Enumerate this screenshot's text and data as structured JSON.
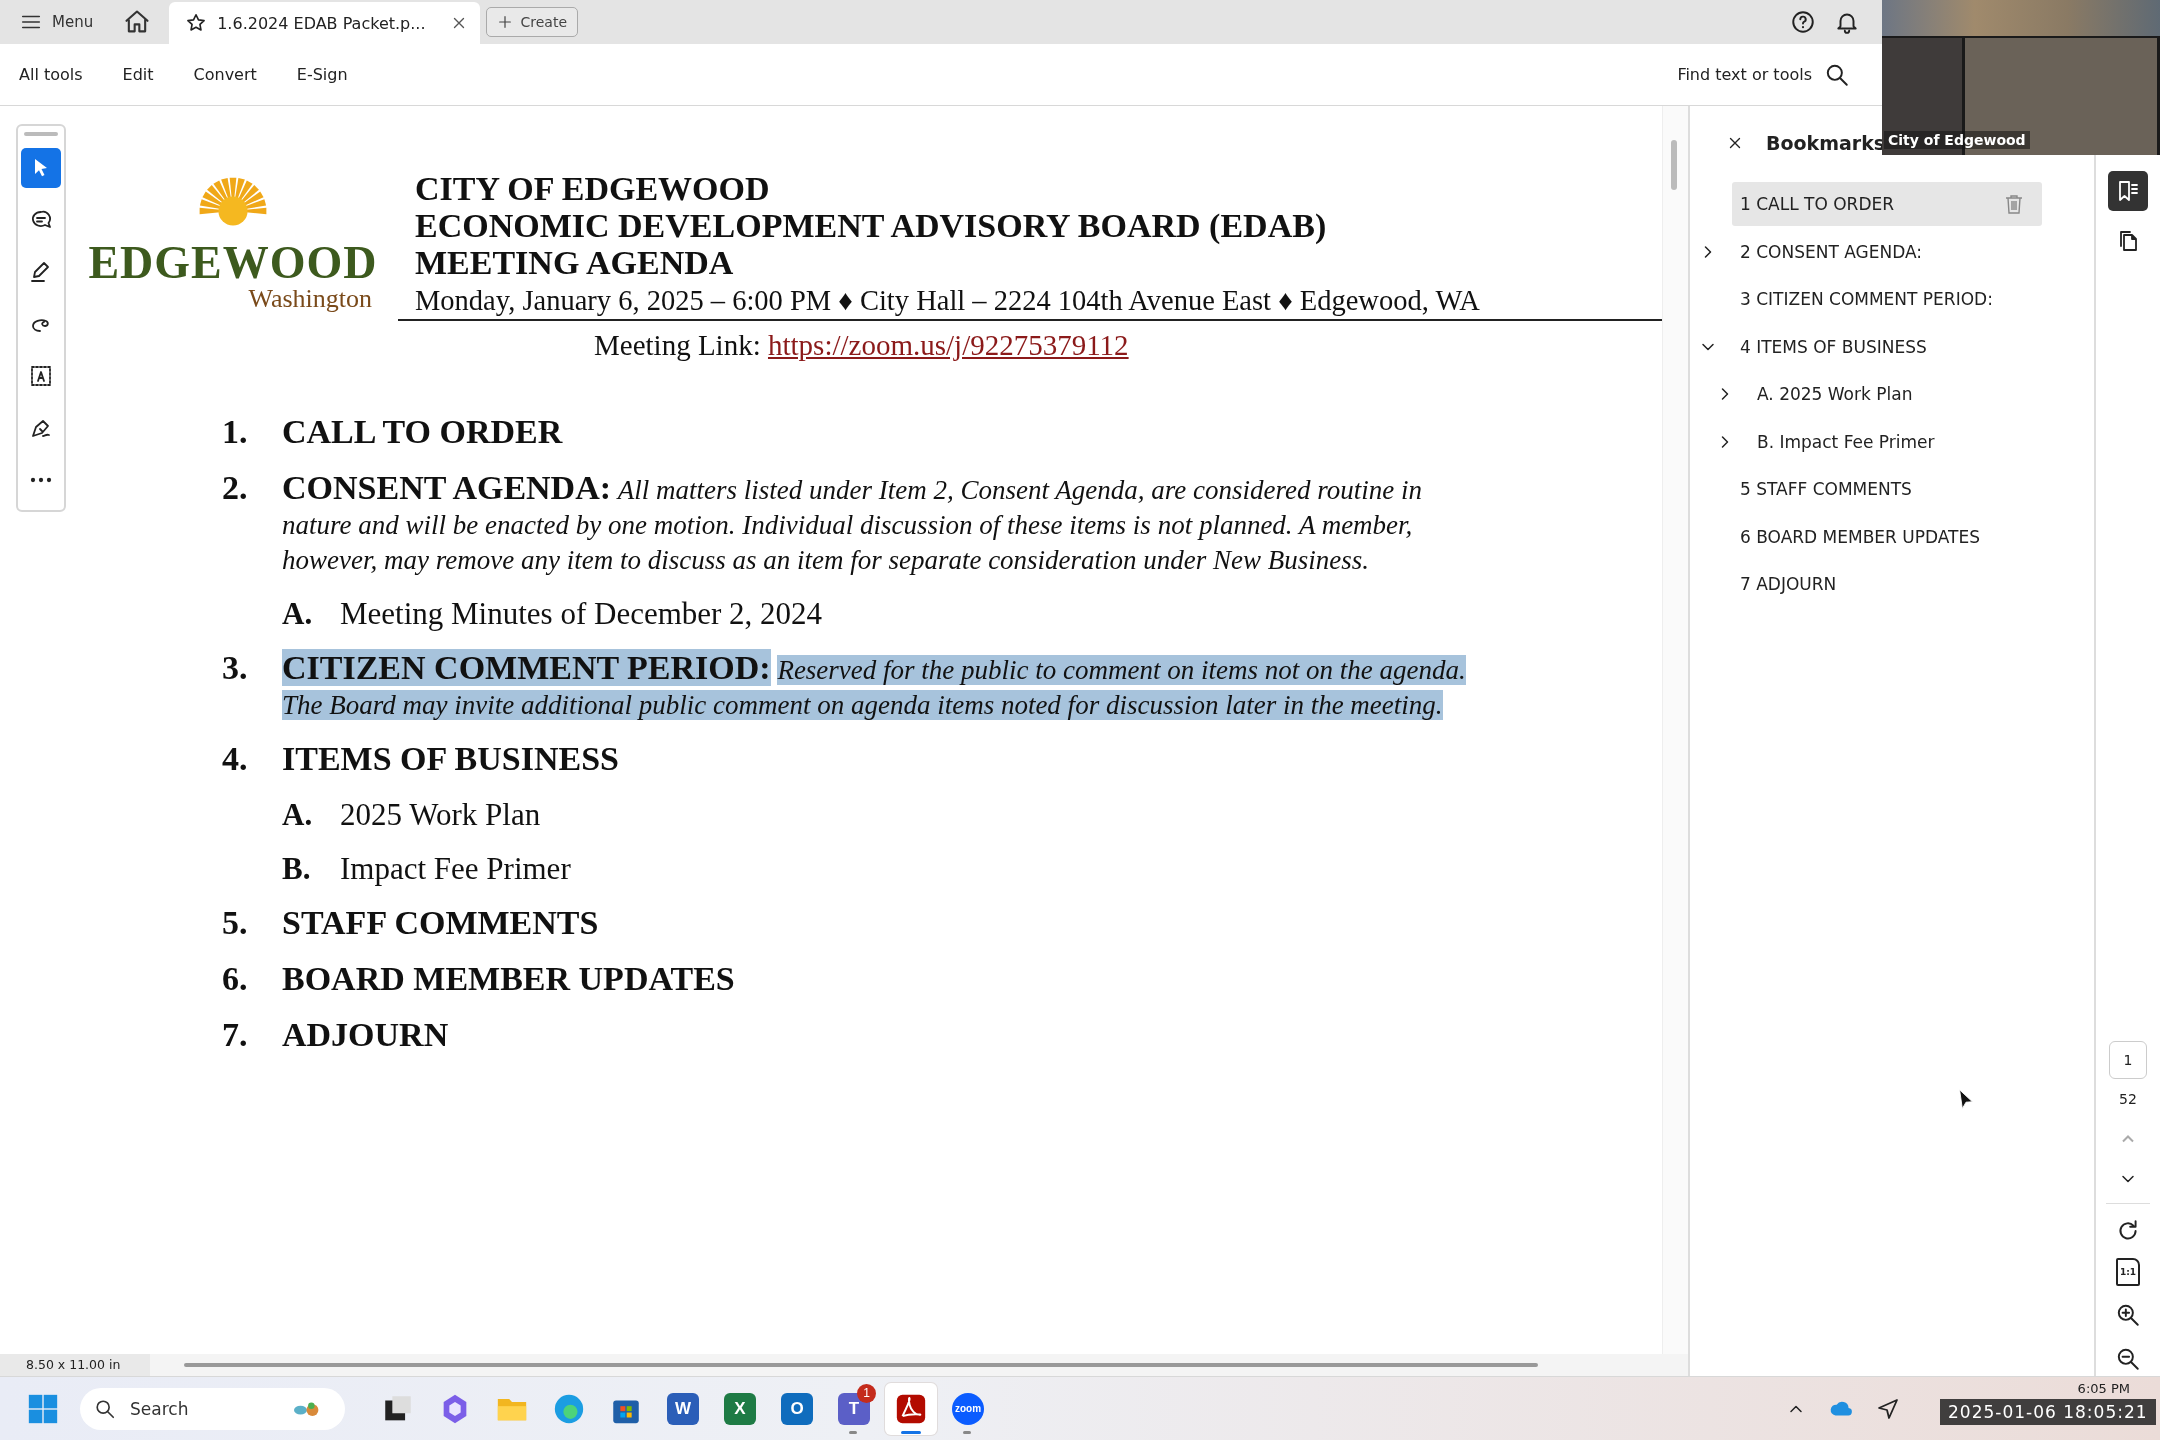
{
  "tab_bar": {
    "menu": "Menu",
    "tabs": [
      {
        "title": "1.6.2024 EDAB Packet.p...",
        "selected": true
      }
    ],
    "create": "Create"
  },
  "toolbar": {
    "menus": [
      "All tools",
      "Edit",
      "Convert",
      "E-Sign"
    ],
    "search": "Find text or tools"
  },
  "tools": [
    {
      "kind": "select",
      "selected": true
    },
    {
      "kind": "comment",
      "selected": false
    },
    {
      "kind": "highlight",
      "selected": false
    },
    {
      "kind": "draw",
      "selected": false
    },
    {
      "kind": "text-box",
      "selected": false
    },
    {
      "kind": "sign",
      "selected": false
    },
    {
      "kind": "more",
      "selected": false
    }
  ],
  "document": {
    "logo": {
      "name": "EDGEWOOD",
      "subtitle": "Washington"
    },
    "title_lines": [
      "CITY OF EDGEWOOD",
      "ECONOMIC DEVELOPMENT ADVISORY BOARD (EDAB)",
      "MEETING AGENDA"
    ],
    "date_line": "Monday, January 6, 2025 – 6:00 PM ♦ City Hall – 2224 104th Avenue East ♦ Edgewood, WA",
    "meeting_link": {
      "label": "Meeting Link:",
      "url": "https://zoom.us/j/92275379112"
    },
    "agenda": [
      {
        "number": "1.",
        "title": "CALL TO ORDER",
        "highlighted": false
      },
      {
        "number": "2.",
        "title": "CONSENT AGENDA:",
        "description": "All matters listed under Item 2, Consent Agenda, are considered routine in nature and will be enacted by one motion. Individual discussion of these items is not planned. A member, however, may remove any item to discuss as an item for separate consideration under New Business.",
        "highlighted": false,
        "children": [
          {
            "letter": "A.",
            "title": "Meeting Minutes of December 2, 2024"
          }
        ]
      },
      {
        "number": "3.",
        "title": "CITIZEN COMMENT PERIOD:",
        "description": "Reserved for the public to comment on items not on the agenda. The Board may invite additional public comment on agenda items noted for discussion later in the meeting.",
        "highlighted": true
      },
      {
        "number": "4.",
        "title": "ITEMS OF BUSINESS",
        "highlighted": false,
        "children": [
          {
            "letter": "A.",
            "title": "2025 Work Plan"
          },
          {
            "letter": "B.",
            "title": "Impact Fee Primer"
          }
        ]
      },
      {
        "number": "5.",
        "title": "STAFF COMMENTS",
        "highlighted": false
      },
      {
        "number": "6.",
        "title": "BOARD MEMBER UPDATES",
        "highlighted": false
      },
      {
        "number": "7.",
        "title": "ADJOURN",
        "highlighted": false
      }
    ]
  },
  "bookmarks": {
    "title": "Bookmarks",
    "items": [
      {
        "label": "1 CALL TO ORDER",
        "selected": true
      },
      {
        "label": "2 CONSENT AGENDA:",
        "expanded": false,
        "selected": false
      },
      {
        "label": "3 CITIZEN COMMENT PERIOD:",
        "selected": false
      },
      {
        "label": "4 ITEMS OF BUSINESS",
        "expanded": true,
        "selected": false,
        "children": [
          {
            "label": "A. 2025 Work Plan",
            "expanded": false,
            "selected": false
          },
          {
            "label": "B. Impact Fee Primer",
            "expanded": false,
            "selected": false
          }
        ]
      },
      {
        "label": "5 STAFF COMMENTS",
        "selected": false
      },
      {
        "label": "6 BOARD MEMBER UPDATES",
        "selected": false
      },
      {
        "label": "7 ADJOURN",
        "selected": false
      }
    ]
  },
  "page_nav": {
    "current": "1",
    "total": "52",
    "actual_size": "1:1"
  },
  "status": {
    "page_size": "8.50 x 11.00 in"
  },
  "video": {
    "caption": "City of Edgewood"
  },
  "taskbar": {
    "search": "Search",
    "apps": [
      {
        "kind": "task-view",
        "running": false,
        "selected": false
      },
      {
        "kind": "copilot",
        "running": false,
        "selected": false
      },
      {
        "kind": "folder",
        "running": false,
        "selected": false
      },
      {
        "kind": "edge",
        "running": false,
        "selected": false
      },
      {
        "kind": "store",
        "running": false,
        "selected": false
      },
      {
        "kind": "word",
        "label": "W",
        "running": false,
        "selected": false
      },
      {
        "kind": "excel",
        "label": "X",
        "running": false,
        "selected": false
      },
      {
        "kind": "outlook",
        "label": "O",
        "running": false,
        "selected": false
      },
      {
        "kind": "teams",
        "label": "T",
        "badge": "1",
        "running": true,
        "selected": false
      },
      {
        "kind": "acrobat",
        "running": true,
        "selected": true
      },
      {
        "kind": "zoom",
        "label": "zoom",
        "running": true,
        "selected": false
      }
    ],
    "clock": "6:05 PM"
  },
  "recording_timestamp": "2025-01-06 18:05:21"
}
